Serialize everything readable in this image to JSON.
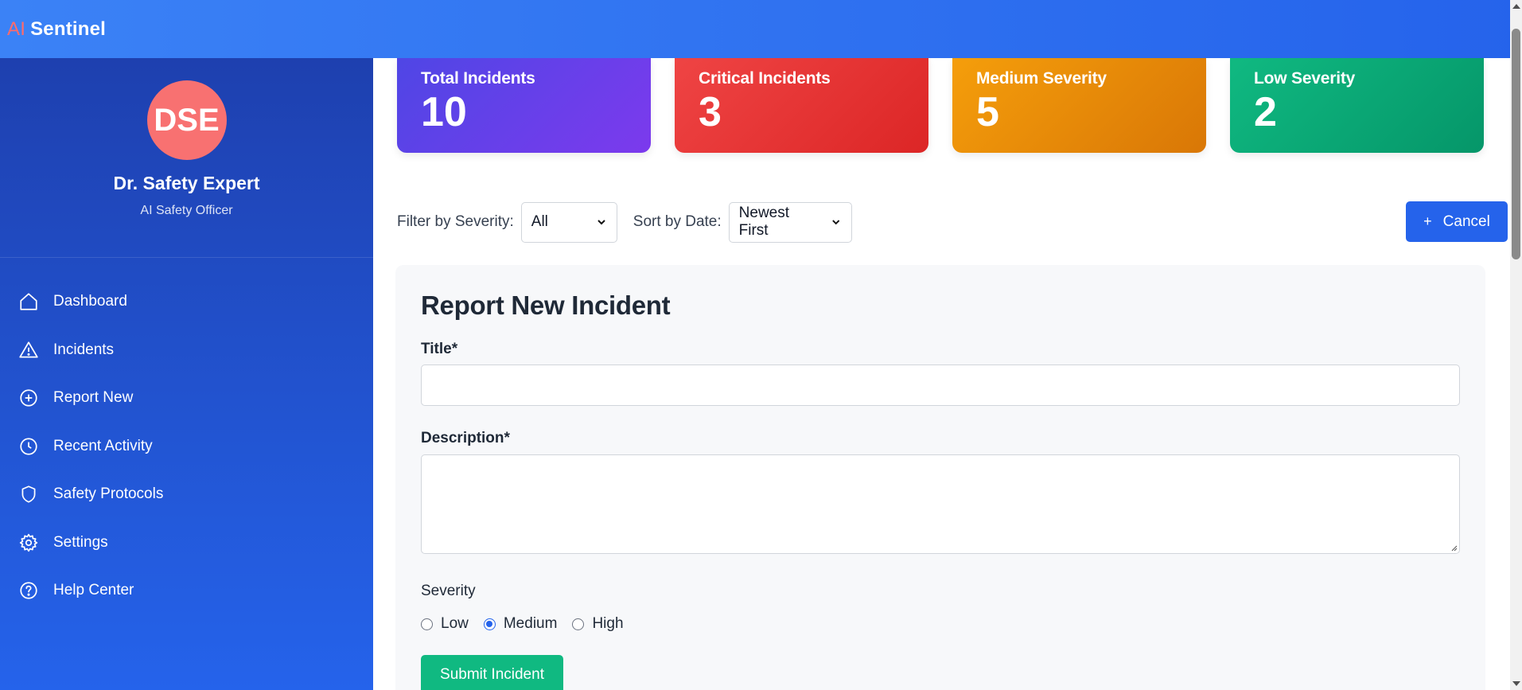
{
  "app": {
    "brand_prefix": "AI",
    "brand_name": "Sentinel"
  },
  "profile": {
    "initials": "DSE",
    "name": "Dr. Safety Expert",
    "role": "AI Safety Officer"
  },
  "nav": [
    {
      "label": "Dashboard",
      "icon": "home-icon"
    },
    {
      "label": "Incidents",
      "icon": "warning-triangle-icon"
    },
    {
      "label": "Report New",
      "icon": "plus-circle-icon"
    },
    {
      "label": "Recent Activity",
      "icon": "clock-icon"
    },
    {
      "label": "Safety Protocols",
      "icon": "shield-icon"
    },
    {
      "label": "Settings",
      "icon": "gear-icon"
    },
    {
      "label": "Help Center",
      "icon": "help-circle-icon"
    }
  ],
  "stats": {
    "total": {
      "label": "Total Incidents",
      "value": "10",
      "color": "#6d3ce8"
    },
    "critical": {
      "label": "Critical Incidents",
      "value": "3",
      "color": "#e53232"
    },
    "medium": {
      "label": "Medium Severity",
      "value": "5",
      "color": "#e98a0a"
    },
    "low": {
      "label": "Low Severity",
      "value": "2",
      "color": "#0ea876"
    }
  },
  "filters": {
    "severity_label": "Filter by Severity:",
    "severity_value": "All",
    "sort_label": "Sort by Date:",
    "sort_value": "Newest First",
    "cancel_icon": "+",
    "cancel_label": "Cancel"
  },
  "form": {
    "heading": "Report New Incident",
    "title_label": "Title*",
    "title_value": "",
    "description_label": "Description*",
    "description_value": "",
    "severity_label": "Severity",
    "severity_options": [
      "Low",
      "Medium",
      "High"
    ],
    "severity_selected": "Medium",
    "submit_label": "Submit Incident"
  },
  "colors": {
    "accent": "#2563eb",
    "submit": "#10b981",
    "avatar": "#f87171",
    "brand_ai": "#ff6b6b"
  }
}
